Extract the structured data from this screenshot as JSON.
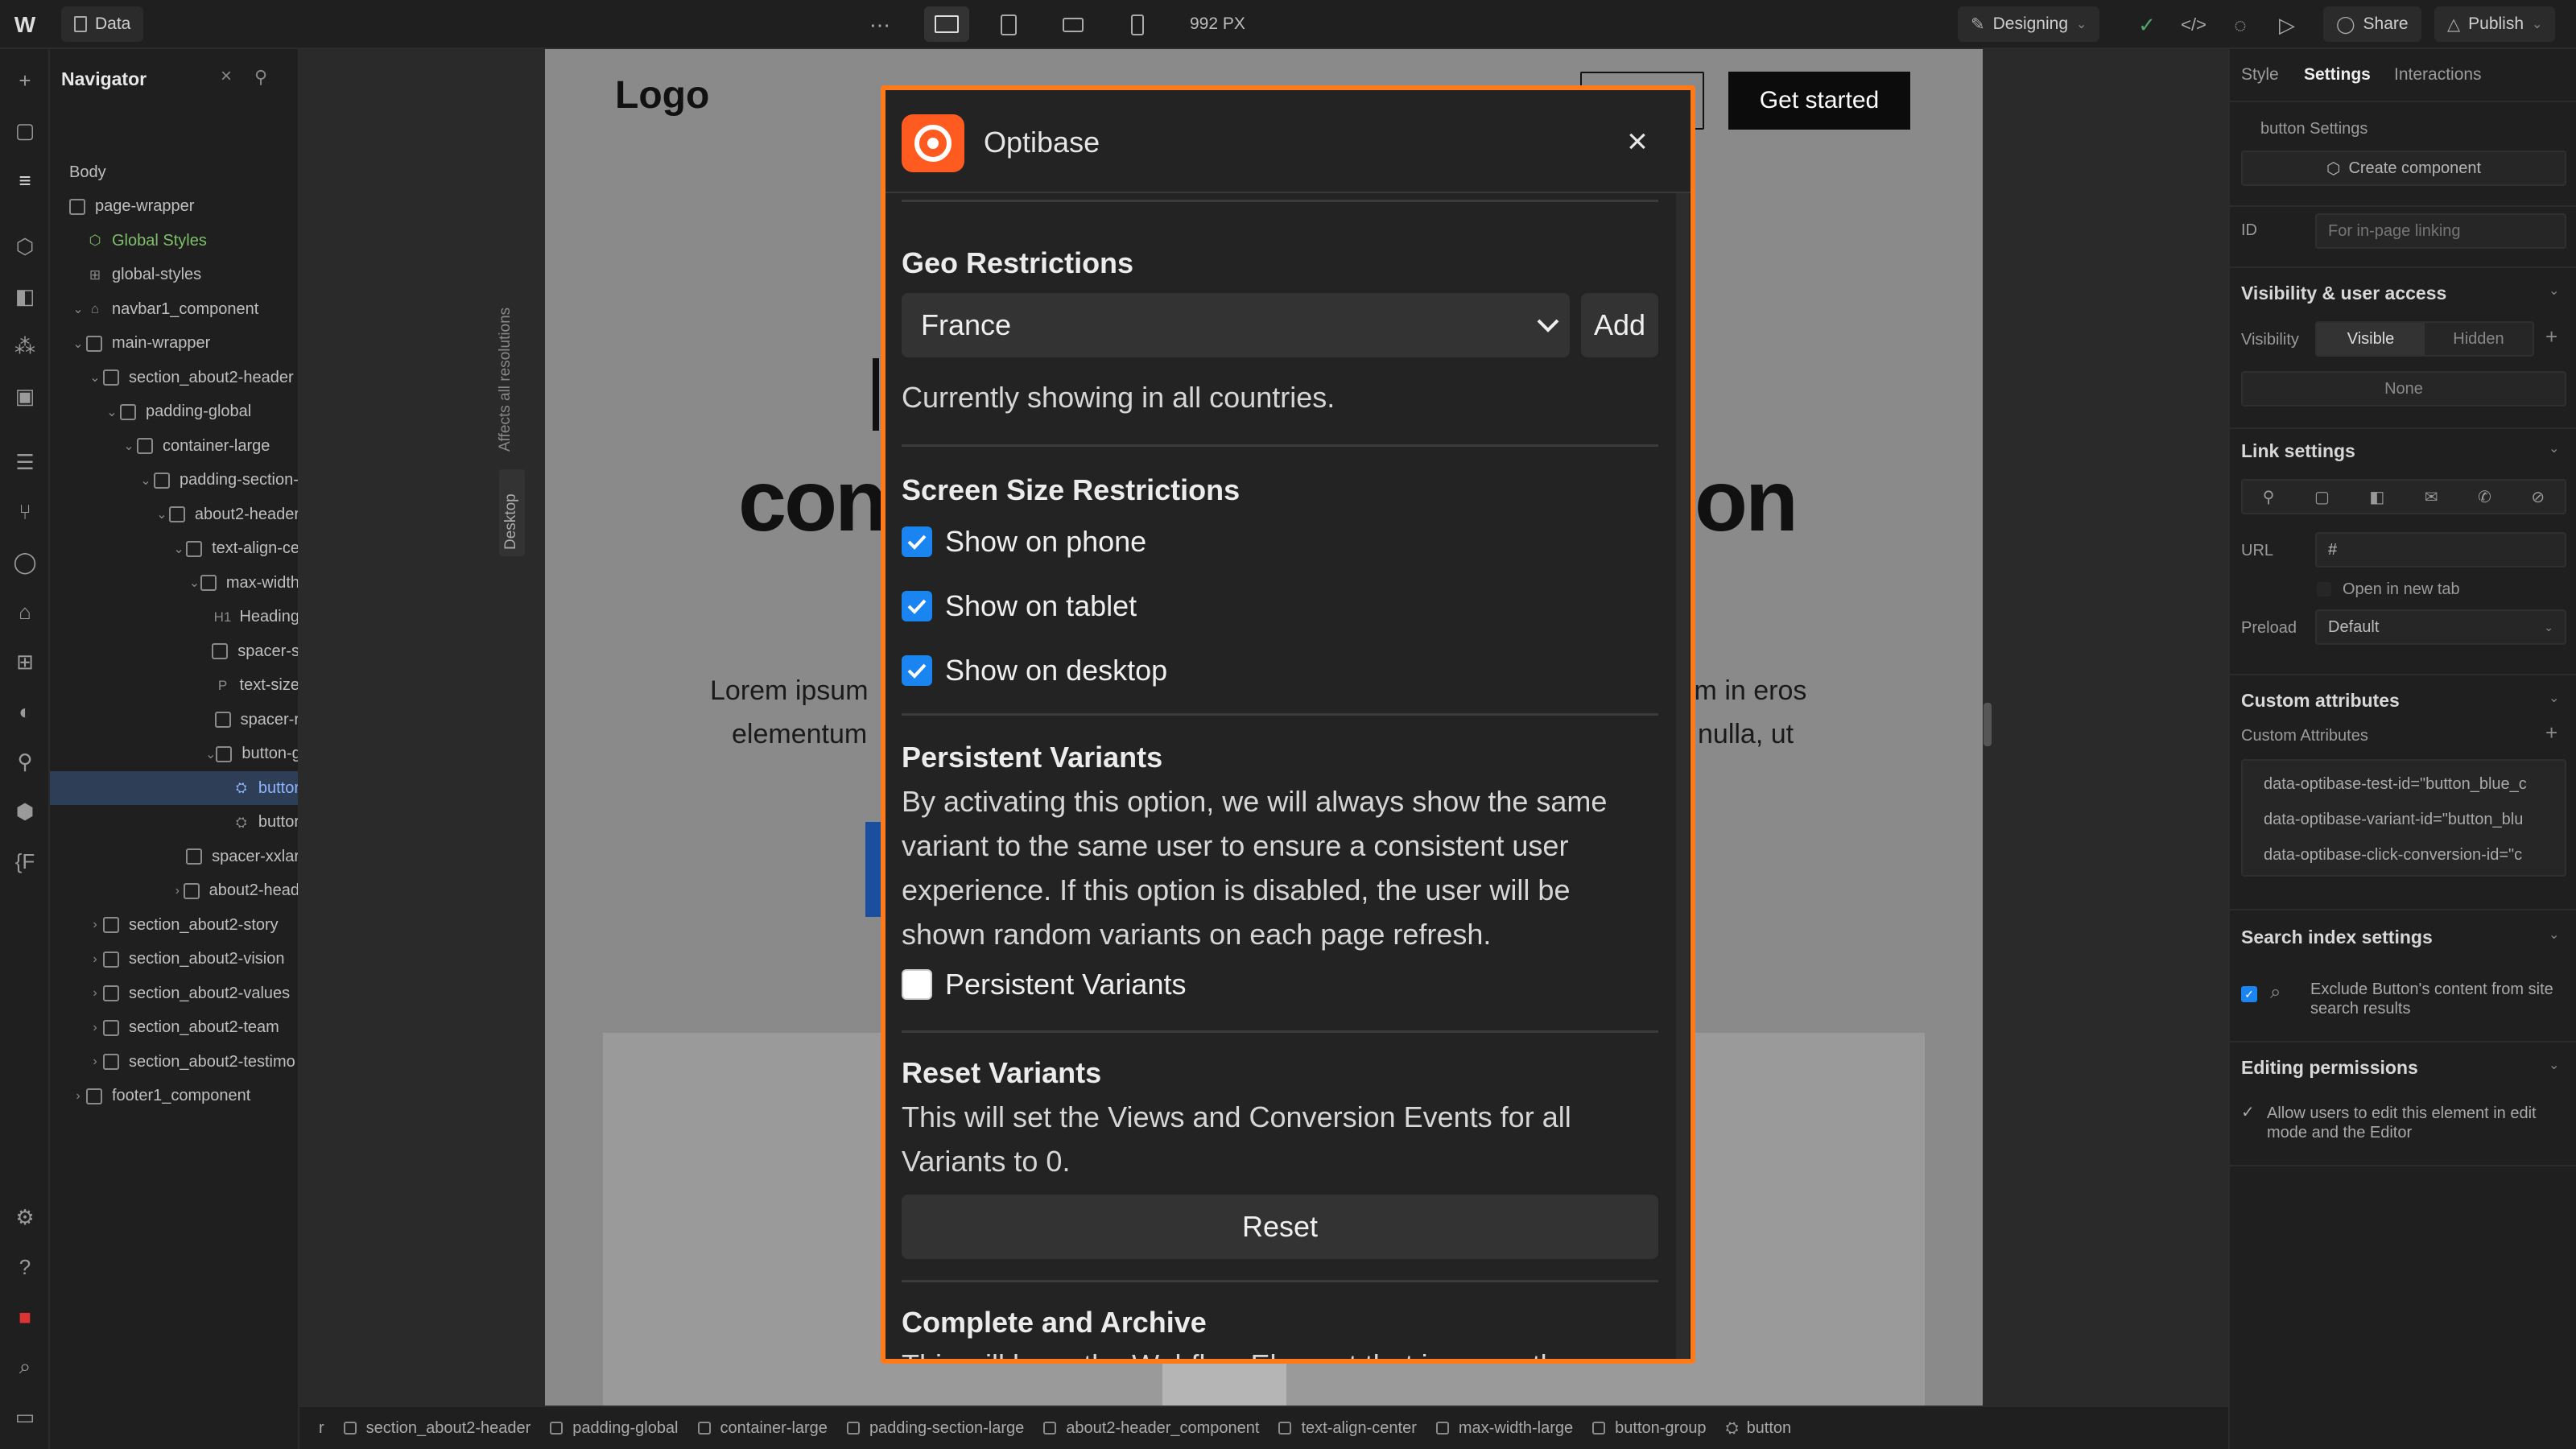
{
  "topbar": {
    "data_tab": "Data",
    "width_readout": "992 PX",
    "mode": "Designing",
    "share": "Share",
    "publish": "Publish"
  },
  "navigator": {
    "title": "Navigator",
    "tree": [
      {
        "label": "Body",
        "depth": 0
      },
      {
        "label": "page-wrapper",
        "depth": 0
      },
      {
        "label": "Global Styles",
        "depth": 1
      },
      {
        "label": "global-styles",
        "depth": 1
      },
      {
        "label": "navbar1_component",
        "depth": 1
      },
      {
        "label": "main-wrapper",
        "depth": 1
      },
      {
        "label": "section_about2-header",
        "depth": 2
      },
      {
        "label": "padding-global",
        "depth": 3
      },
      {
        "label": "container-large",
        "depth": 4
      },
      {
        "label": "padding-section-",
        "depth": 5
      },
      {
        "label": "about2-header",
        "depth": 6
      },
      {
        "label": "text-align-ce",
        "depth": 7
      },
      {
        "label": "max-width",
        "depth": 8
      },
      {
        "label": "Heading",
        "depth": 9
      },
      {
        "label": "spacer-s",
        "depth": 9
      },
      {
        "label": "text-size",
        "depth": 9
      },
      {
        "label": "spacer-r",
        "depth": 9
      },
      {
        "label": "button-g",
        "depth": 9
      },
      {
        "label": "buttor",
        "depth": 10
      },
      {
        "label": "buttor",
        "depth": 10
      },
      {
        "label": "spacer-xxlar",
        "depth": 7
      },
      {
        "label": "about2-head",
        "depth": 7
      },
      {
        "label": "section_about2-story",
        "depth": 2
      },
      {
        "label": "section_about2-vision",
        "depth": 2
      },
      {
        "label": "section_about2-values",
        "depth": 2
      },
      {
        "label": "section_about2-team",
        "depth": 2
      },
      {
        "label": "section_about2-testimo",
        "depth": 2
      },
      {
        "label": "footer1_component",
        "depth": 1
      }
    ]
  },
  "canvas": {
    "side_label_1": "Affects all resolutions",
    "side_label_2": "Desktop",
    "logo": "Logo",
    "cta": "Get started",
    "heading_left": "con",
    "heading_right": "on",
    "lorem_left_1": "Lorem ipsum",
    "lorem_left_2": "elementum",
    "lorem_right_1": "im in eros",
    "lorem_right_2": "nulla, ut"
  },
  "modal": {
    "title": "Optibase",
    "geo_heading": "Geo Restrictions",
    "country": "France",
    "add": "Add",
    "geo_status": "Currently showing in all countries.",
    "screen_heading": "Screen Size Restrictions",
    "phone": "Show on phone",
    "tablet": "Show on tablet",
    "desktop": "Show on desktop",
    "persist_heading": "Persistent Variants",
    "persist_text": "By activating this option, we will always show the same variant to the same user to ensure a consistent user experience. If this option is disabled, the user will be shown random variants on each page refresh.",
    "persist_check": "Persistent Variants",
    "reset_heading": "Reset Variants",
    "reset_text": "This will set the Views and Conversion Events for all Variants to 0.",
    "reset_button": "Reset",
    "archive_heading": "Complete and Archive",
    "archive_text_partial": "This will keep the Webflow Element that is currently"
  },
  "rightpanel": {
    "tabs": [
      "Style",
      "Settings",
      "Interactions"
    ],
    "element_label": "button Settings",
    "create_component": "Create component",
    "id_label": "ID",
    "id_placeholder": "For in-page linking",
    "visibility_heading": "Visibility & user access",
    "visibility_label": "Visibility",
    "visible": "Visible",
    "hidden": "Hidden",
    "none": "None",
    "link_heading": "Link settings",
    "url_label": "URL",
    "url_value": "#",
    "open_new_tab": "Open in new tab",
    "preload_label": "Preload",
    "preload_value": "Default",
    "custom_attr_heading": "Custom attributes",
    "custom_attr_label": "Custom Attributes",
    "attrs": [
      "data-optibase-test-id=\"button_blue_c",
      "data-optibase-variant-id=\"button_blu",
      "data-optibase-click-conversion-id=\"c"
    ],
    "search_heading": "Search index settings",
    "search_text": "Exclude Button's content from site search results",
    "editing_heading": "Editing permissions",
    "editing_text": "Allow users to edit this element in edit mode and the Editor"
  },
  "breadcrumb": [
    "r",
    "section_about2-header",
    "padding-global",
    "container-large",
    "padding-section-large",
    "about2-header_component",
    "text-align-center",
    "max-width-large",
    "button-group",
    "button"
  ]
}
